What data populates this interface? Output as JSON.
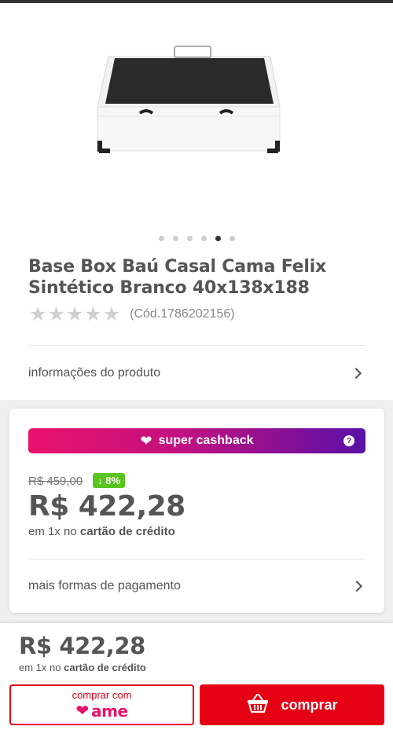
{
  "product": {
    "title": "Base Box Baú Casal Cama Felix Sintético Branco 40x138x188",
    "code": "(Cód.1786202156)",
    "rating_stars": 0,
    "info_link": "informações do produto",
    "carousel": {
      "total": 6,
      "active_index": 4
    }
  },
  "pricing": {
    "cashback_label": "super cashback",
    "cashback_help": "?",
    "old_price": "R$ 459,00",
    "discount": "↓ 8%",
    "price": "R$ 422,28",
    "installments_prefix": "em 1x no",
    "installments_bold": "cartão de crédito",
    "more_payments": "mais formas de pagamento"
  },
  "bottom_bar": {
    "price": "R$ 422,28",
    "installments_prefix": "em 1x no",
    "installments_bold": "cartão de crédito",
    "ame_label": "comprar com",
    "ame_brand": "ame",
    "buy_label": "comprar"
  },
  "colors": {
    "accent_red": "#e60014",
    "discount_green": "#5ac41e",
    "cashback_gradient_start": "#e8126b",
    "cashback_gradient_end": "#5a10a6"
  },
  "icons": [
    "heart-diamond-icon",
    "help-icon",
    "chevron-right-icon",
    "basket-icon",
    "ame-heart-icon"
  ]
}
